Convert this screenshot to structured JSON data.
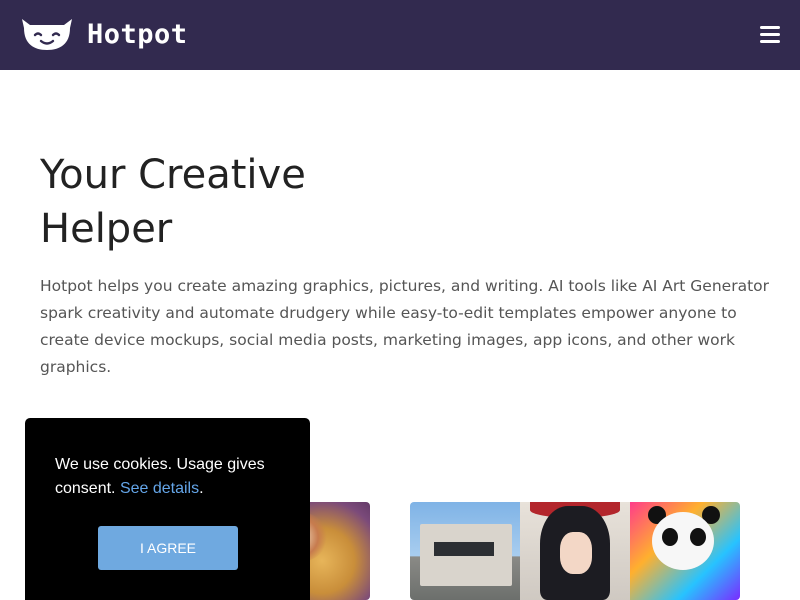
{
  "header": {
    "brand": "Hotpot",
    "logo_icon": "smiling-pot-logo-icon",
    "menu_icon": "hamburger-menu-icon",
    "background_color": "#322a4f"
  },
  "hero": {
    "title_line1": "Your Creative",
    "title_line2": "Helper",
    "description": "Hotpot helps you create amazing graphics, pictures, and writing. AI tools like AI Art Generator spark creativity and automate drudgery while easy-to-edit templates empower anyone to create device mockups, social media posts, marketing images, app icons, and other work graphics."
  },
  "cookie_banner": {
    "text": "We use cookies. Usage gives consent. ",
    "link_label": "See details",
    "period": ".",
    "button_label": "I AGREE",
    "button_color": "#6fa9e0",
    "link_color": "#64a5e8"
  }
}
